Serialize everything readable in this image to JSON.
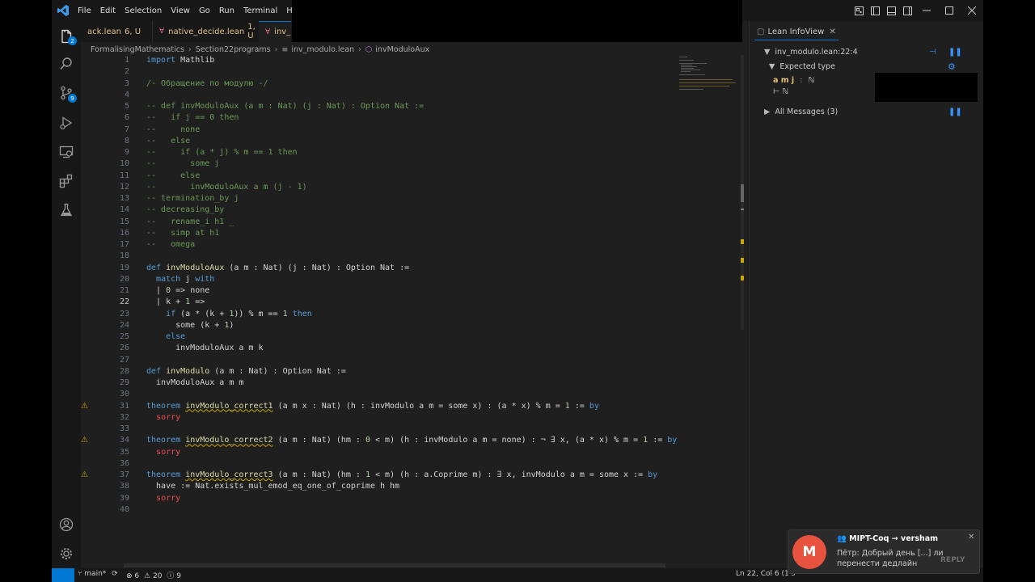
{
  "menu": [
    "File",
    "Edit",
    "Selection",
    "View",
    "Go",
    "Run",
    "Terminal",
    "Help"
  ],
  "tabs": [
    {
      "name": "ack.lean",
      "status": "6, U"
    },
    {
      "name": "native_decide.lean",
      "status": "1, U"
    },
    {
      "name": "inv_",
      "status": ""
    }
  ],
  "breadcrumb": [
    "FormalisingMathematics",
    "Section22programs",
    "inv_modulo.lean",
    "invModuloAux"
  ],
  "activity_badges": {
    "explorer": "2",
    "scm": "9"
  },
  "code_lines": [
    {
      "n": "1",
      "text": "import Mathlib"
    },
    {
      "n": "2",
      "text": ""
    },
    {
      "n": "3",
      "text": "/- Обращение по модулю -/"
    },
    {
      "n": "4",
      "text": ""
    },
    {
      "n": "5",
      "text": "-- def invModuloAux (a m : Nat) (j : Nat) : Option Nat :="
    },
    {
      "n": "6",
      "text": "--   if j == 0 then"
    },
    {
      "n": "7",
      "text": "--     none"
    },
    {
      "n": "8",
      "text": "--   else"
    },
    {
      "n": "9",
      "text": "--     if (a * j) % m == 1 then"
    },
    {
      "n": "10",
      "text": "--       some j"
    },
    {
      "n": "11",
      "text": "--     else"
    },
    {
      "n": "12",
      "text": "--       invModuloAux a m (j - 1)"
    },
    {
      "n": "13",
      "text": "-- termination_by j"
    },
    {
      "n": "14",
      "text": "-- decreasing_by"
    },
    {
      "n": "15",
      "text": "--   rename_i h1 _"
    },
    {
      "n": "16",
      "text": "--   simp at h1"
    },
    {
      "n": "17",
      "text": "--   omega"
    },
    {
      "n": "18",
      "text": ""
    },
    {
      "n": "19",
      "text": "def invModuloAux (a m : Nat) (j : Nat) : Option Nat :="
    },
    {
      "n": "20",
      "text": "  match j with"
    },
    {
      "n": "21",
      "text": "  | 0 => none"
    },
    {
      "n": "22",
      "text": "  | k + 1 =>"
    },
    {
      "n": "23",
      "text": "    if (a * (k + 1)) % m == 1 then"
    },
    {
      "n": "24",
      "text": "      some (k + 1)"
    },
    {
      "n": "25",
      "text": "    else"
    },
    {
      "n": "26",
      "text": "      invModuloAux a m k"
    },
    {
      "n": "27",
      "text": ""
    },
    {
      "n": "28",
      "text": "def invModulo (a m : Nat) : Option Nat :="
    },
    {
      "n": "29",
      "text": "  invModuloAux a m m"
    },
    {
      "n": "30",
      "text": ""
    },
    {
      "n": "31",
      "text": "theorem invModulo_correct1 (a m x : Nat) (h : invModulo a m = some x) : (a * x) % m = 1 := by"
    },
    {
      "n": "32",
      "text": "  sorry"
    },
    {
      "n": "33",
      "text": ""
    },
    {
      "n": "34",
      "text": "theorem invModulo_correct2 (a m : Nat) (hm : 0 < m) (h : invModulo a m = none) : ¬ ∃ x, (a * x) % m = 1 := by"
    },
    {
      "n": "35",
      "text": "  sorry"
    },
    {
      "n": "36",
      "text": ""
    },
    {
      "n": "37",
      "text": "theorem invModulo_correct3 (a m : Nat) (hm : 1 < m) (h : a.Coprime m) : ∃ x, invModulo a m = some x := by"
    },
    {
      "n": "38",
      "text": "  have := Nat.exists_mul_emod_eq_one_of_coprime h hm"
    },
    {
      "n": "39",
      "text": "  sorry"
    },
    {
      "n": "40",
      "text": ""
    }
  ],
  "infoview": {
    "tab": "Lean InfoView",
    "location": "inv_modulo.lean:22:4",
    "expected_type": "Expected type",
    "hyp_names": "a m j",
    "hyp_colon": ":",
    "hyp_type": "ℕ",
    "goal": "⊢ ℕ",
    "all_messages": "All Messages (3)"
  },
  "statusbar": {
    "branch": "main*",
    "errors": "6",
    "warnings": "20",
    "info": "9",
    "position": "Ln 22, Col 6 (1 s"
  },
  "notification": {
    "avatar_letter": "M",
    "title": "MIPT-Coq → versham",
    "body": "Пётр: Добрый день [...] ли перенести дедлайн",
    "reply": "REPLY"
  }
}
